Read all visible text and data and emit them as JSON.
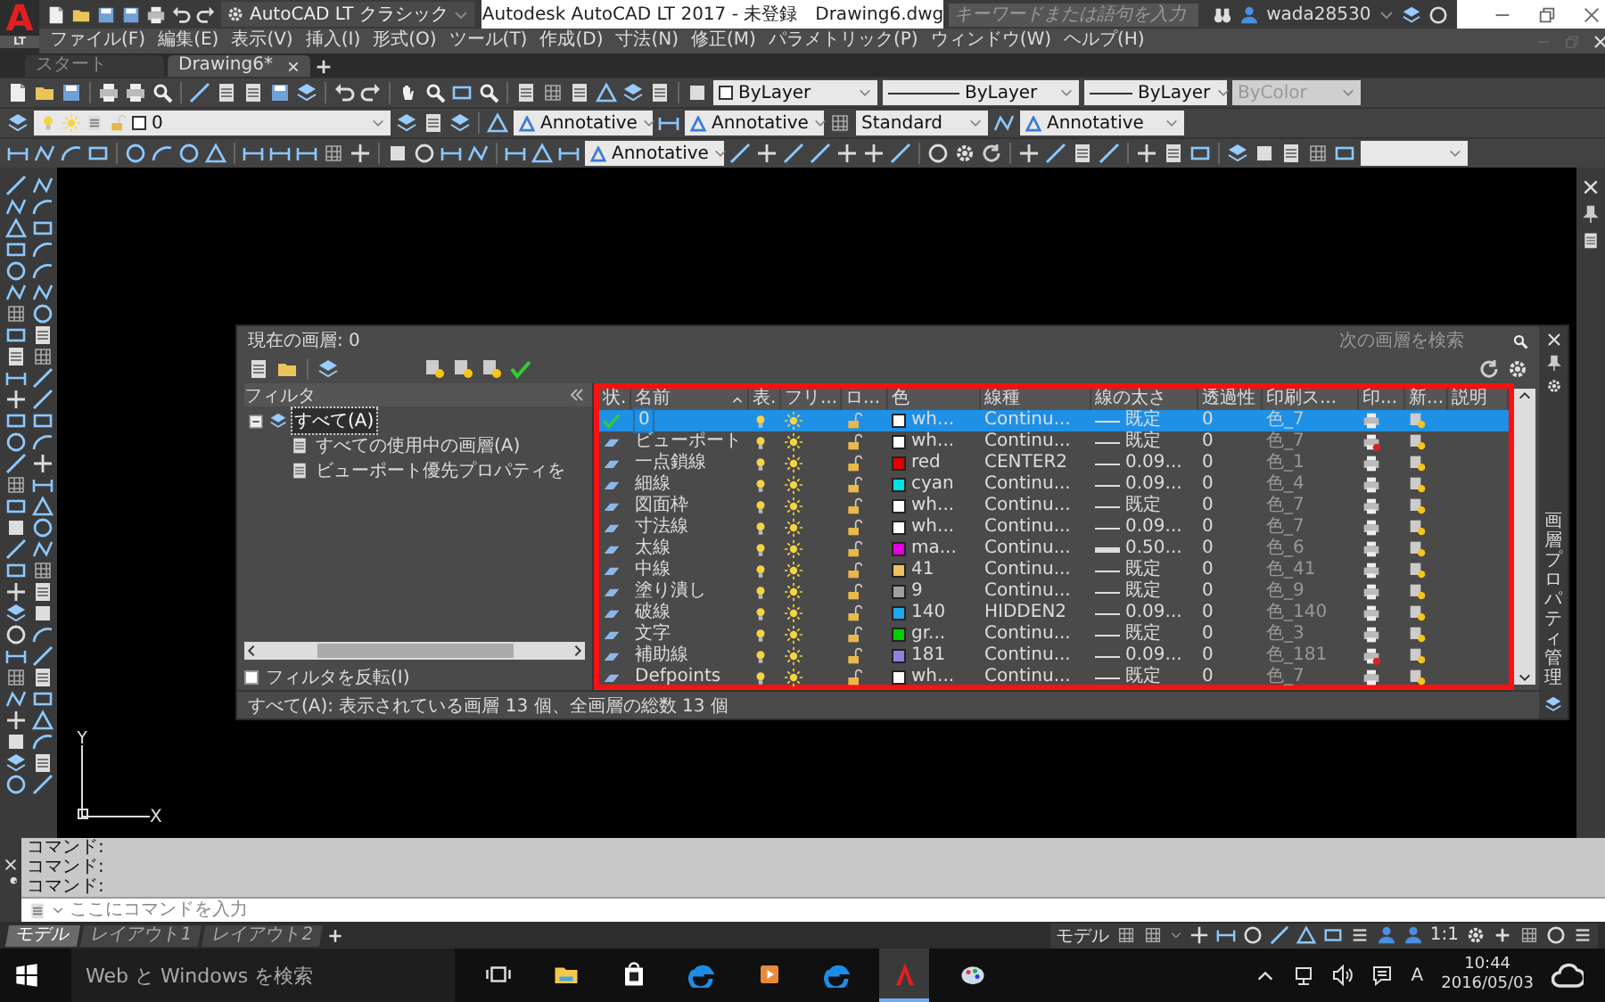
{
  "app_logo": {
    "letter": "A",
    "edition": "LT"
  },
  "quick_access": {
    "workspace": "AutoCAD LT クラシック"
  },
  "window": {
    "title": "Autodesk AutoCAD LT 2017 - 未登録",
    "file": "Drawing6.dwg"
  },
  "search": {
    "placeholder": "キーワードまたは語句を入力"
  },
  "user": {
    "name": "wada28530"
  },
  "menu": [
    "ファイル(F)",
    "編集(E)",
    "表示(V)",
    "挿入(I)",
    "形式(O)",
    "ツール(T)",
    "作成(D)",
    "寸法(N)",
    "修正(M)",
    "パラメトリック(P)",
    "ウィンドウ(W)",
    "ヘルプ(H)"
  ],
  "doc_tabs": [
    {
      "label": "スタート",
      "selected": false
    },
    {
      "label": "Drawing6*",
      "selected": true
    }
  ],
  "property_dropdowns": [
    {
      "kind": "swatch",
      "value": "ByLayer",
      "disabled": false
    },
    {
      "kind": "line",
      "value": "ByLayer",
      "disabled": false
    },
    {
      "kind": "line",
      "value": "ByLayer",
      "disabled": false
    },
    {
      "kind": "plain",
      "value": "ByColor",
      "disabled": true
    }
  ],
  "layer_dropdown": {
    "value": "0"
  },
  "style_dropdowns": [
    {
      "value": "Annotative",
      "annotative": true
    },
    {
      "value": "Annotative",
      "annotative": true
    },
    {
      "value": "Standard",
      "annotative": false
    },
    {
      "value": "Annotative",
      "annotative": true
    }
  ],
  "dim_dropdown": {
    "value": "Annotative",
    "annotative": true
  },
  "layer_palette": {
    "current_layer": "現在の画層: 0",
    "search_placeholder": "次の画層を検索",
    "filter_title": "フィルタ",
    "filters": [
      {
        "label": "すべて(A)",
        "expanded": true,
        "selected": true,
        "children": [
          {
            "label": "すべての使用中の画層(A)",
            "selected": false
          },
          {
            "label": "ビューポート優先プロパティを",
            "selected": false
          }
        ]
      }
    ],
    "invert_filter": {
      "label": "フィルタを反転(I)",
      "checked": false
    },
    "columns": [
      {
        "label": "状.",
        "sorted": false
      },
      {
        "label": "名前",
        "sorted": true
      },
      {
        "label": "表.",
        "sorted": false
      },
      {
        "label": "フリ...",
        "sorted": false
      },
      {
        "label": "ロ...",
        "sorted": false
      },
      {
        "label": "色",
        "sorted": false
      },
      {
        "label": "線種",
        "sorted": false
      },
      {
        "label": "線の太さ",
        "sorted": false
      },
      {
        "label": "透過性",
        "sorted": false
      },
      {
        "label": "印刷ス...",
        "sorted": false
      },
      {
        "label": "印...",
        "sorted": false
      },
      {
        "label": "新...",
        "sorted": false
      },
      {
        "label": "説明",
        "sorted": false
      }
    ],
    "rows": [
      {
        "current": true,
        "selected": true,
        "name": "0",
        "on": true,
        "frozen": false,
        "locked": false,
        "color": "#ffffff",
        "color_name": "wh...",
        "linetype": "Continu...",
        "lineweight": "既定",
        "heavy": false,
        "transparency": "0",
        "plot_style": "色_7",
        "plot": true
      },
      {
        "current": false,
        "selected": false,
        "name": "ビューポート",
        "on": true,
        "frozen": false,
        "locked": false,
        "color": "#ffffff",
        "color_name": "wh...",
        "linetype": "Continu...",
        "lineweight": "既定",
        "heavy": false,
        "transparency": "0",
        "plot_style": "色_7",
        "plot": false
      },
      {
        "current": false,
        "selected": false,
        "name": "一点鎖線",
        "on": true,
        "frozen": false,
        "locked": false,
        "color": "#e00000",
        "color_name": "red",
        "linetype": "CENTER2",
        "lineweight": "0.09...",
        "heavy": false,
        "transparency": "0",
        "plot_style": "色_1",
        "plot": true
      },
      {
        "current": false,
        "selected": false,
        "name": "細線",
        "on": true,
        "frozen": false,
        "locked": false,
        "color": "#00e0e0",
        "color_name": "cyan",
        "linetype": "Continu...",
        "lineweight": "0.09...",
        "heavy": false,
        "transparency": "0",
        "plot_style": "色_4",
        "plot": true
      },
      {
        "current": false,
        "selected": false,
        "name": "図面枠",
        "on": true,
        "frozen": false,
        "locked": false,
        "color": "#ffffff",
        "color_name": "wh...",
        "linetype": "Continu...",
        "lineweight": "既定",
        "heavy": false,
        "transparency": "0",
        "plot_style": "色_7",
        "plot": true
      },
      {
        "current": false,
        "selected": false,
        "name": "寸法線",
        "on": true,
        "frozen": false,
        "locked": false,
        "color": "#ffffff",
        "color_name": "wh...",
        "linetype": "Continu...",
        "lineweight": "0.09...",
        "heavy": false,
        "transparency": "0",
        "plot_style": "色_7",
        "plot": true
      },
      {
        "current": false,
        "selected": false,
        "name": "太線",
        "on": true,
        "frozen": false,
        "locked": false,
        "color": "#e000e0",
        "color_name": "ma...",
        "linetype": "Continu...",
        "lineweight": "0.50...",
        "heavy": true,
        "transparency": "0",
        "plot_style": "色_6",
        "plot": true
      },
      {
        "current": false,
        "selected": false,
        "name": "中線",
        "on": true,
        "frozen": false,
        "locked": false,
        "color": "#f0c060",
        "color_name": "41",
        "linetype": "Continu...",
        "lineweight": "既定",
        "heavy": false,
        "transparency": "0",
        "plot_style": "色_41",
        "plot": true
      },
      {
        "current": false,
        "selected": false,
        "name": "塗り潰し",
        "on": true,
        "frozen": false,
        "locked": false,
        "color": "#a0a0a0",
        "color_name": "9",
        "linetype": "Continu...",
        "lineweight": "既定",
        "heavy": false,
        "transparency": "0",
        "plot_style": "色_9",
        "plot": true
      },
      {
        "current": false,
        "selected": false,
        "name": "破線",
        "on": true,
        "frozen": false,
        "locked": false,
        "color": "#20a8e8",
        "color_name": "140",
        "linetype": "HIDDEN2",
        "lineweight": "0.09...",
        "heavy": false,
        "transparency": "0",
        "plot_style": "色_140",
        "plot": true
      },
      {
        "current": false,
        "selected": false,
        "name": "文字",
        "on": true,
        "frozen": false,
        "locked": false,
        "color": "#00d000",
        "color_name": "gr...",
        "linetype": "Continu...",
        "lineweight": "既定",
        "heavy": false,
        "transparency": "0",
        "plot_style": "色_3",
        "plot": true
      },
      {
        "current": false,
        "selected": false,
        "name": "補助線",
        "on": true,
        "frozen": false,
        "locked": false,
        "color": "#9080e0",
        "color_name": "181",
        "linetype": "Continu...",
        "lineweight": "0.09...",
        "heavy": false,
        "transparency": "0",
        "plot_style": "色_181",
        "plot": false
      },
      {
        "current": false,
        "selected": false,
        "name": "Defpoints",
        "on": true,
        "frozen": false,
        "locked": false,
        "color": "#ffffff",
        "color_name": "wh...",
        "linetype": "Continu...",
        "lineweight": "既定",
        "heavy": false,
        "transparency": "0",
        "plot_style": "色_7",
        "plot": true
      }
    ],
    "status": "すべて(A): 表示されている画層 13 個、全画層の総数 13 個",
    "side_title": "画層プロパティ管理"
  },
  "ucs": {
    "x": "X",
    "y": "Y"
  },
  "command": {
    "history": [
      "コマンド:",
      "コマンド:",
      "コマンド:"
    ],
    "placeholder": "ここにコマンドを入力"
  },
  "layout_tabs": [
    {
      "label": "モデル",
      "selected": true
    },
    {
      "label": "レイアウト1",
      "selected": false
    },
    {
      "label": "レイアウト2",
      "selected": false
    }
  ],
  "status_bar": {
    "space": "モデル",
    "scale": "1:1"
  },
  "taskbar": {
    "search_placeholder": "Web と Windows を検索",
    "ime": "A",
    "time": "10:44",
    "date": "2016/05/03"
  }
}
